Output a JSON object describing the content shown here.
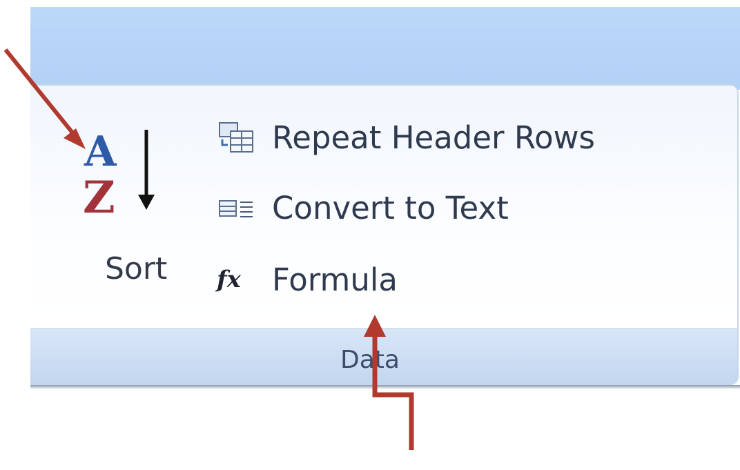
{
  "ribbon": {
    "group_label": "Data",
    "sort": {
      "label": "Sort",
      "icon": "sort-az-icon",
      "letters": [
        "A",
        "Z"
      ]
    },
    "commands": [
      {
        "label": "Repeat Header Rows",
        "icon": "repeat-header-rows-icon"
      },
      {
        "label": "Convert to Text",
        "icon": "convert-to-text-icon"
      },
      {
        "label": "Formula",
        "icon": "formula-icon",
        "icon_text": "fx"
      }
    ]
  },
  "annotations": [
    {
      "name": "arrow-to-sort",
      "color": "#b03a2e"
    },
    {
      "name": "arrow-to-formula",
      "color": "#b03a2e"
    }
  ]
}
